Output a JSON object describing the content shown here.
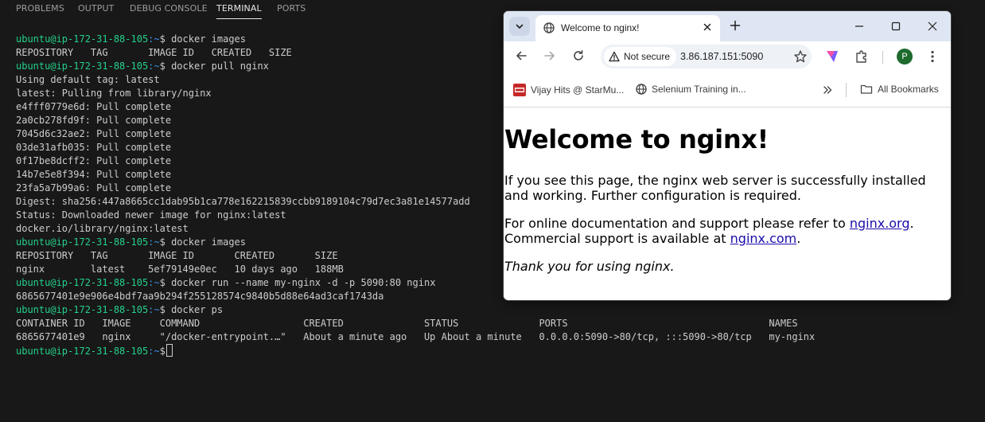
{
  "panel_tabs": [
    {
      "label": "PROBLEMS",
      "active": false
    },
    {
      "label": "OUTPUT",
      "active": false
    },
    {
      "label": "DEBUG CONSOLE",
      "active": false
    },
    {
      "label": "TERMINAL",
      "active": true
    },
    {
      "label": "PORTS",
      "active": false
    }
  ],
  "terminal": {
    "prompt_user": "ubuntu@ip-172-31-88-105",
    "prompt_path": ":~",
    "prompt_symbol": "$",
    "lines": [
      {
        "prompt": true,
        "cmd": " docker images"
      },
      {
        "text": "REPOSITORY   TAG       IMAGE ID   CREATED   SIZE"
      },
      {
        "prompt": true,
        "cmd": " docker pull nginx"
      },
      {
        "text": "Using default tag: latest"
      },
      {
        "text": "latest: Pulling from library/nginx"
      },
      {
        "text": "e4fff0779e6d: Pull complete"
      },
      {
        "text": "2a0cb278fd9f: Pull complete"
      },
      {
        "text": "7045d6c32ae2: Pull complete"
      },
      {
        "text": "03de31afb035: Pull complete"
      },
      {
        "text": "0f17be8dcff2: Pull complete"
      },
      {
        "text": "14b7e5e8f394: Pull complete"
      },
      {
        "text": "23fa5a7b99a6: Pull complete"
      },
      {
        "text": "Digest: sha256:447a8665cc1dab95b1ca778e162215839ccbb9189104c79d7ec3a81e14577add"
      },
      {
        "text": "Status: Downloaded newer image for nginx:latest"
      },
      {
        "text": "docker.io/library/nginx:latest"
      },
      {
        "prompt": true,
        "cmd": " docker images"
      },
      {
        "text": "REPOSITORY   TAG       IMAGE ID       CREATED       SIZE"
      },
      {
        "text": "nginx        latest    5ef79149e0ec   10 days ago   188MB"
      },
      {
        "prompt": true,
        "cmd": " docker run --name my-nginx -d -p 5090:80 nginx"
      },
      {
        "text": "6865677401e9e906e4bdf7aa9b294f255128574c9840b5d88e64ad3caf1743da"
      },
      {
        "prompt": true,
        "cmd": " docker ps"
      },
      {
        "text": "CONTAINER ID   IMAGE     COMMAND                  CREATED              STATUS              PORTS                                   NAMES"
      },
      {
        "text": "6865677401e9   nginx     \"/docker-entrypoint.…\"   About a minute ago   Up About a minute   0.0.0.0:5090->80/tcp, :::5090->80/tcp   my-nginx"
      },
      {
        "prompt": true,
        "cmd": " ",
        "cursor": true
      }
    ]
  },
  "browser": {
    "tab_title": "Welcome to nginx!",
    "security_label": "Not secure",
    "url": "3.86.187.151:5090",
    "profile_initial": "P",
    "bookmarks": [
      {
        "label": "Vijay Hits @ StarMu..."
      },
      {
        "label": "Selenium Training in..."
      }
    ],
    "all_bookmarks_label": "All Bookmarks",
    "page": {
      "heading": "Welcome to nginx!",
      "para1": "If you see this page, the nginx web server is successfully installed and working. Further configuration is required.",
      "para2_prefix": "For online documentation and support please refer to ",
      "para2_link": "nginx.org",
      "para2_suffix": ".",
      "para3_prefix": "Commercial support is available at ",
      "para3_link": "nginx.com",
      "para3_suffix": ".",
      "thanks": "Thank you for using nginx."
    }
  },
  "colors": {
    "terminal_bg": "#181818",
    "prompt_user": "#23d18b",
    "prompt_path": "#3b8eea",
    "link": "#1a0dab"
  }
}
